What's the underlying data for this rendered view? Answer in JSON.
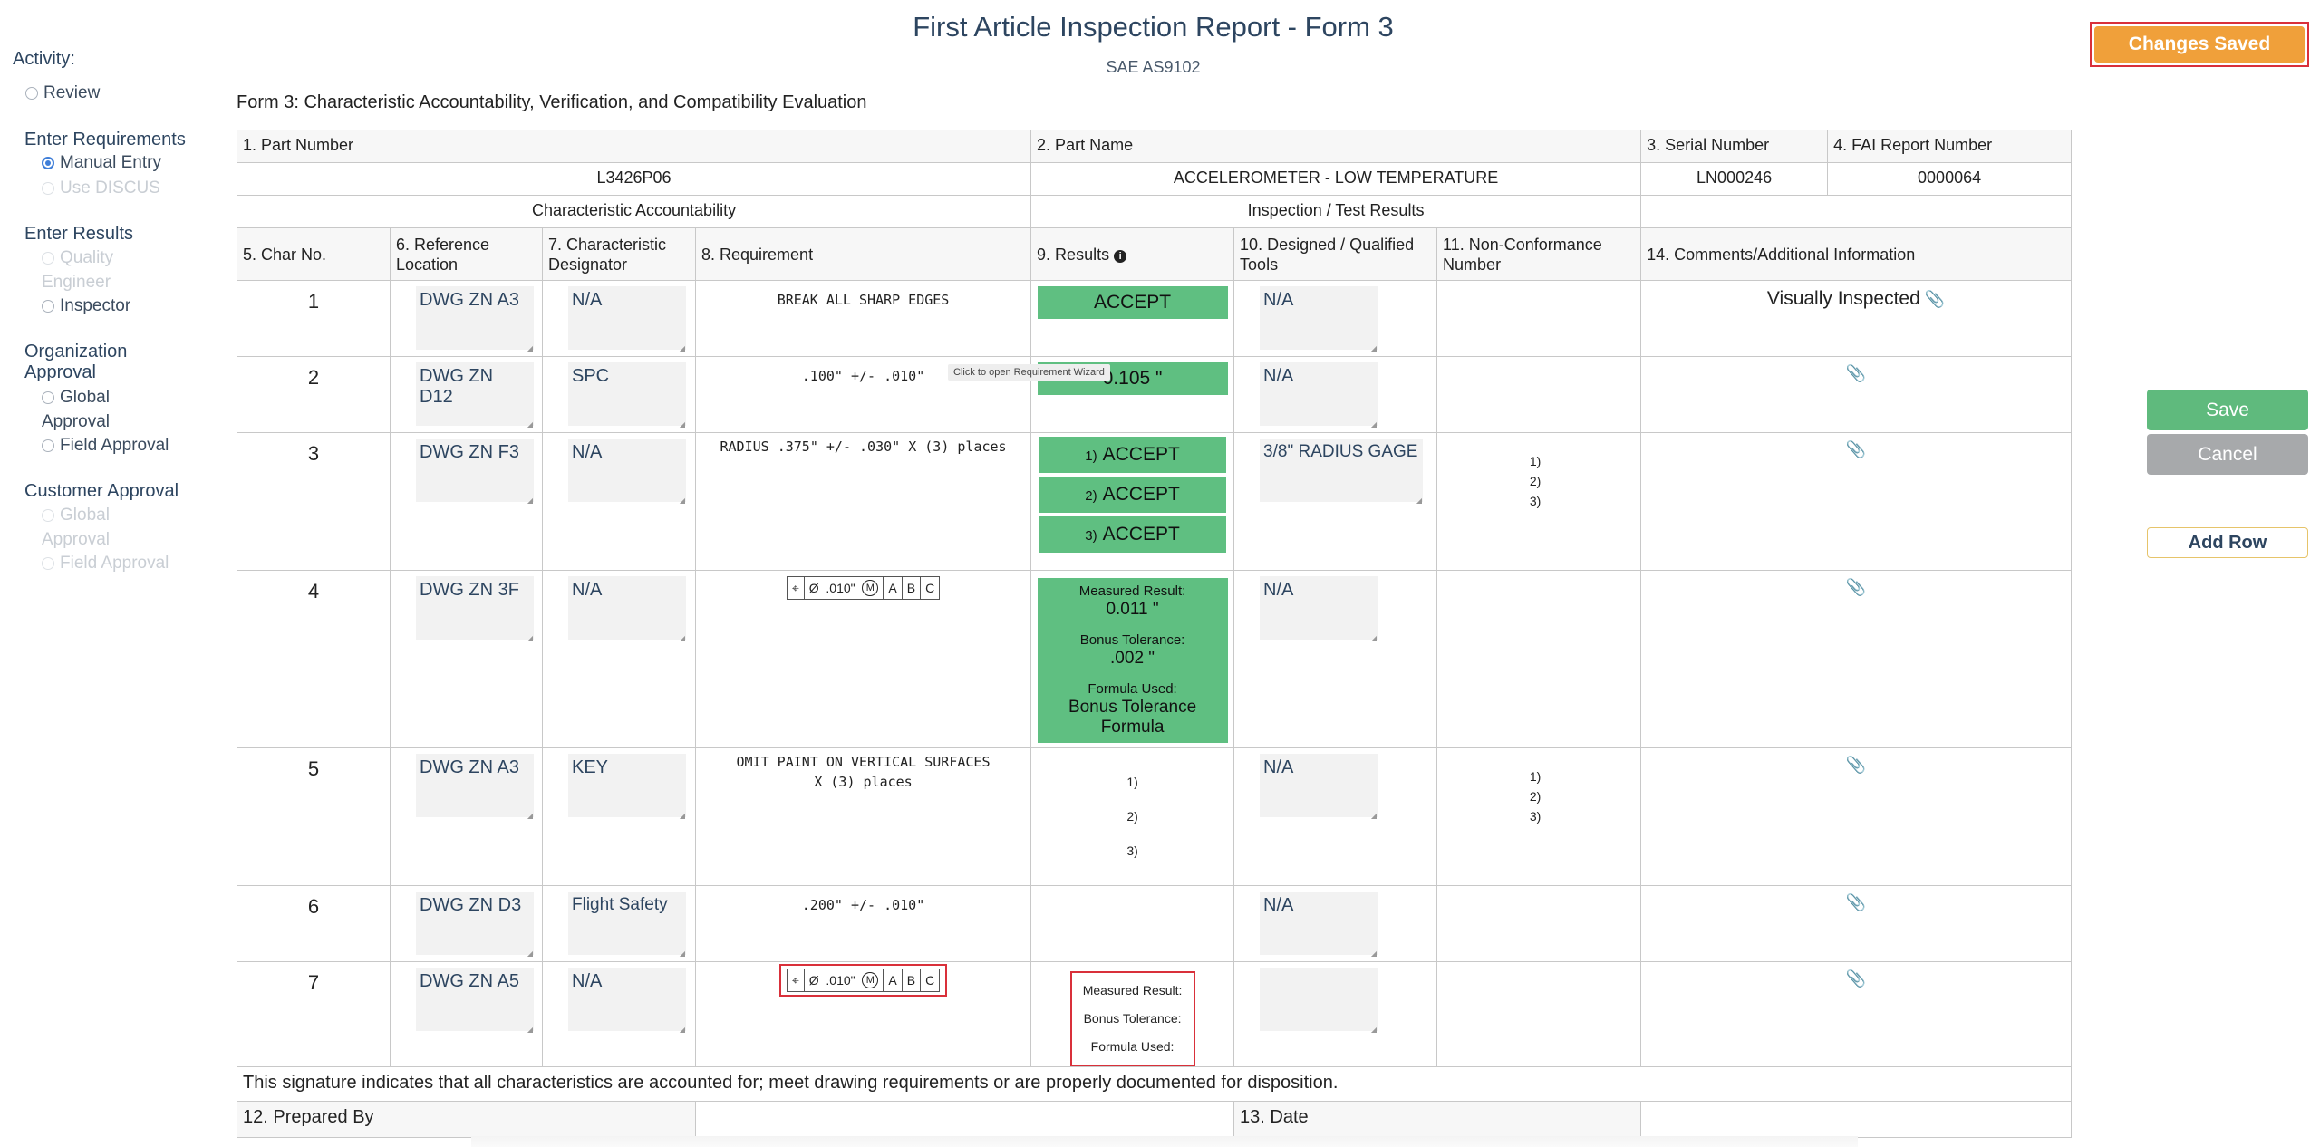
{
  "sidebar": {
    "activity_label": "Activity:",
    "review": "Review",
    "enter_requirements_label": "Enter Requirements",
    "manual_entry": "Manual Entry",
    "use_discus": "Use DISCUS",
    "enter_results_label": "Enter Results",
    "quality": "Quality",
    "engineer": "Engineer",
    "inspector": "Inspector",
    "org_approval_label_1": "Organization",
    "org_approval_label_2": "Approval",
    "org_global": "Global",
    "org_approval_cont": "Approval",
    "org_field_approval": "Field Approval",
    "cust_approval_label": "Customer Approval",
    "cust_global": "Global",
    "cust_approval_cont": "Approval",
    "cust_field_approval": "Field Approval"
  },
  "header": {
    "title": "First Article Inspection Report - Form 3",
    "subtitle": "SAE AS9102",
    "form_heading": "Form 3: Characteristic Accountability, Verification, and Compatibility Evaluation"
  },
  "buttons": {
    "changes_saved": "Changes Saved",
    "save": "Save",
    "cancel": "Cancel",
    "add_row": "Add Row"
  },
  "tooltip": "Click to open Requirement Wizard",
  "info": {
    "part_number_label": "1. Part Number",
    "part_name_label": "2. Part Name",
    "serial_number_label": "3. Serial Number",
    "fai_report_label": "4. FAI Report Number",
    "part_number": "L3426P06",
    "part_name": "ACCELEROMETER - LOW TEMPERATURE",
    "serial_number": "LN000246",
    "fai_report_number": "0000064"
  },
  "sections": {
    "accountability": "Characteristic Accountability",
    "inspection": "Inspection / Test Results"
  },
  "columns": {
    "char_no": "5. Char No.",
    "ref_location": "6. Reference Location",
    "char_designator": "7. Characteristic Designator",
    "requirement": "8. Requirement",
    "results": "9. Results",
    "tools": "10. Designed / Qualified Tools",
    "nonconformance": "11. Non-Conformance Number",
    "comments": "14. Comments/Additional Information"
  },
  "rows": [
    {
      "num": "1",
      "ref": "DWG ZN A3",
      "desig": "N/A",
      "req": "BREAK ALL SHARP EDGES",
      "result": "ACCEPT",
      "tool": "N/A",
      "comment": "Visually Inspected"
    },
    {
      "num": "2",
      "ref": "DWG ZN D12",
      "desig": "SPC",
      "req": ".100\" +/- .010\"",
      "result": "0.105 \"",
      "tool": "N/A"
    },
    {
      "num": "3",
      "ref": "DWG ZN F3",
      "desig": "N/A",
      "req": "RADIUS .375\" +/- .030\" X (3) places",
      "results": [
        {
          "idx": "1)",
          "val": "ACCEPT"
        },
        {
          "idx": "2)",
          "val": "ACCEPT"
        },
        {
          "idx": "3)",
          "val": "ACCEPT"
        }
      ],
      "tool": "3/8\" RADIUS GAGE",
      "nc": [
        "1)",
        "2)",
        "3)"
      ]
    },
    {
      "num": "4",
      "ref": "DWG ZN 3F",
      "desig": "N/A",
      "fcf": {
        "symbol": "⌖",
        "dia": "Ø",
        "tol": ".010\"",
        "mod": "M",
        "a": "A",
        "b": "B",
        "c": "C"
      },
      "measured_label": "Measured Result:",
      "measured": "0.011 \"",
      "bonus_label": "Bonus Tolerance:",
      "bonus": ".002 \"",
      "formula_label": "Formula Used:",
      "formula": "Bonus Tolerance Formula",
      "tool": "N/A"
    },
    {
      "num": "5",
      "ref": "DWG ZN A3",
      "desig": "KEY",
      "req_line1": "OMIT PAINT ON VERTICAL SURFACES",
      "req_line2": "X (3) places",
      "results_idx": [
        "1)",
        "2)",
        "3)"
      ],
      "tool": "N/A",
      "nc": [
        "1)",
        "2)",
        "3)"
      ]
    },
    {
      "num": "6",
      "ref": "DWG ZN D3",
      "desig": "Flight Safety",
      "req": ".200\" +/- .010\"",
      "tool": "N/A"
    },
    {
      "num": "7",
      "ref": "DWG ZN A5",
      "desig": "N/A",
      "fcf": {
        "symbol": "⌖",
        "dia": "Ø",
        "tol": ".010\"",
        "mod": "M",
        "a": "A",
        "b": "B",
        "c": "C"
      },
      "measured_label": "Measured Result:",
      "bonus_label": "Bonus Tolerance:",
      "formula_label": "Formula Used:"
    }
  ],
  "signature": "This signature indicates that all characteristics are accounted for; meet drawing requirements or are properly documented for disposition.",
  "footer": {
    "prepared_by": "12. Prepared By",
    "date": "13. Date"
  },
  "colors": {
    "accept_green": "#5fbf81",
    "changes_saved_orange": "#f0a03a",
    "highlight_red": "#d9303a",
    "title_blue": "#2d4560"
  },
  "icons": {
    "info": "info-icon",
    "clip": "paperclip-icon"
  }
}
